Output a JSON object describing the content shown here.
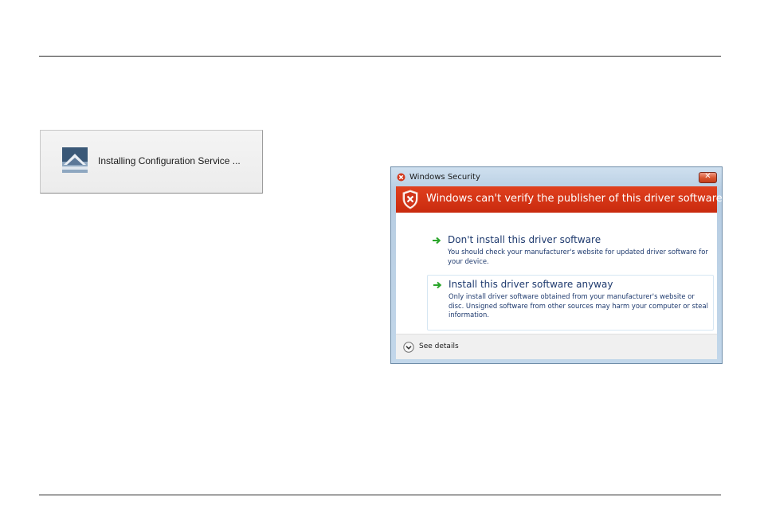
{
  "install_dialog": {
    "message": "Installing Configuration Service ..."
  },
  "security_dialog": {
    "title": "Windows Security",
    "close_label": "✕",
    "banner_text": "Windows can't verify the publisher of this driver software",
    "options": [
      {
        "title": "Don't install this driver software",
        "description": "You should check your manufacturer's website for updated driver software for your device."
      },
      {
        "title": "Install this driver software anyway",
        "description": "Only install driver software obtained from your manufacturer's website or disc. Unsigned software from other sources may harm your computer or steal information."
      }
    ],
    "details_label": "See details"
  },
  "colors": {
    "banner_red": "#d3361a",
    "option_text": "#1e3a6e",
    "arrow_green": "#2aa52a"
  }
}
